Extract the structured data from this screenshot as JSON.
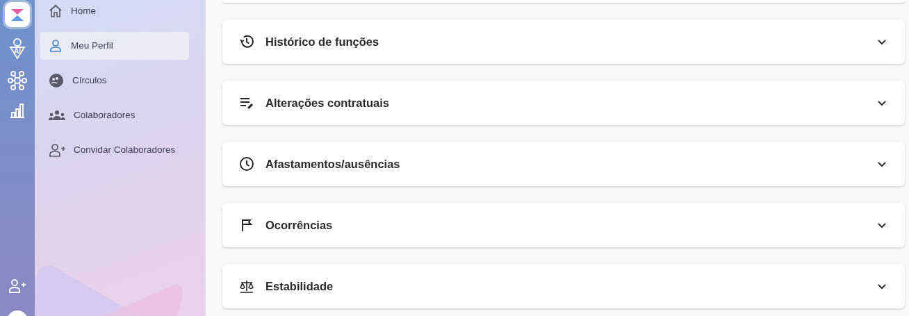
{
  "rail": {
    "ai_label": "AI"
  },
  "sidebar": {
    "items": [
      {
        "label": "Home",
        "selected": false
      },
      {
        "label": "Meu Perfil",
        "selected": true
      },
      {
        "label": "Círculos",
        "selected": false
      },
      {
        "label": "Colaboradores",
        "selected": false
      },
      {
        "label": "Convidar Colaboradores",
        "selected": false
      }
    ]
  },
  "sections": [
    {
      "title": "Histórico de funções",
      "expanded": false
    },
    {
      "title": "Alterações contratuais",
      "expanded": false
    },
    {
      "title": "Afastamentos/ausências",
      "expanded": false
    },
    {
      "title": "Ocorrências",
      "expanded": false
    },
    {
      "title": "Estabilidade",
      "expanded": false
    }
  ]
}
